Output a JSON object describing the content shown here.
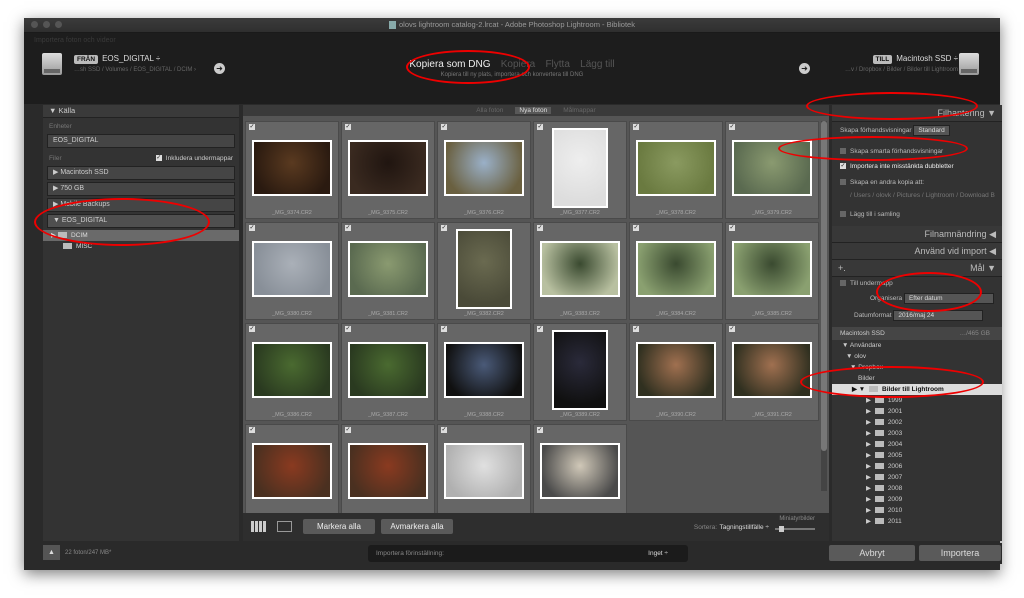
{
  "window": {
    "title": "olovs lightroom catalog-2.lrcat - Adobe Photoshop Lightroom - Bibliotek"
  },
  "top": {
    "faded": "Importera foton och videor",
    "from": {
      "badge": "FRÅN",
      "name": "EOS_DIGITAL ÷",
      "path": "…sh SSD / Volumes / EOS_DIGITAL / DCIM ›"
    },
    "modes": [
      "Kopiera som DNG",
      "Kopiera",
      "Flytta",
      "Lägg till"
    ],
    "mode_sub": "Kopiera till ny plats, importera och konvertera till DNG",
    "to": {
      "badge": "TILL",
      "name": "Macintosh SSD ÷",
      "path": "…v / Dropbox / Bilder / Bilder till Lightroom"
    }
  },
  "left": {
    "title": "Källa",
    "devices_h": "Enheter",
    "device": "EOS_DIGITAL",
    "files_h": "Filer",
    "include_sub": "Inkludera undermappar",
    "volumes": [
      "Macintosh SSD",
      "750 GB",
      "Mobile Backups",
      "EOS_DIGITAL"
    ],
    "tree": [
      "DCIM",
      "MISC"
    ]
  },
  "filters": [
    "Alla foton",
    "Nya foton",
    "Målmappar"
  ],
  "photos": [
    {
      "name": "_MG_9374.CR2"
    },
    {
      "name": "_MG_9375.CR2"
    },
    {
      "name": "_MG_9376.CR2"
    },
    {
      "name": "_MG_9377.CR2"
    },
    {
      "name": "_MG_9378.CR2"
    },
    {
      "name": "_MG_9379.CR2"
    },
    {
      "name": "_MG_9380.CR2"
    },
    {
      "name": "_MG_9381.CR2"
    },
    {
      "name": "_MG_9382.CR2"
    },
    {
      "name": "_MG_9383.CR2"
    },
    {
      "name": "_MG_9384.CR2"
    },
    {
      "name": "_MG_9385.CR2"
    },
    {
      "name": "_MG_9386.CR2"
    },
    {
      "name": "_MG_9387.CR2"
    },
    {
      "name": "_MG_9388.CR2"
    },
    {
      "name": "_MG_9389.CR2"
    },
    {
      "name": "_MG_9390.CR2"
    },
    {
      "name": "_MG_9391.CR2"
    },
    {
      "name": ""
    },
    {
      "name": ""
    },
    {
      "name": ""
    },
    {
      "name": ""
    }
  ],
  "toolbar": {
    "select_all": "Markera alla",
    "deselect_all": "Avmarkera alla",
    "sort_label": "Sortera:",
    "sort_value": "Tagningstillfälle ÷",
    "thumbs_label": "Miniatyrbilder"
  },
  "right": {
    "file_handling": "Filhantering",
    "previews_label": "Skapa förhandsvisningar",
    "previews_value": "Standard",
    "smart": "Skapa smarta förhandsvisningar",
    "dupes": "Importera inte misstänkta dubbletter",
    "second_copy": "Skapa en andra kopia att:",
    "second_path": "/ Users / olovk / Pictures / Lightroom / Download B",
    "collection": "Lägg till i samling",
    "file_rename": "Filnamnändring",
    "apply": "Använd vid import",
    "dest": "Mål",
    "subfolder": "Till undermapp",
    "organize_label": "Organisera",
    "organize_value": "Efter datum",
    "date_label": "Datumformat",
    "date_value": "2016/maj 24",
    "volume": "Macintosh SSD",
    "volume_free": "…/465 GB",
    "tree": [
      "Användare",
      "olov",
      "Dropbox",
      "Bilder",
      "Bilder till Lightroom",
      "1999",
      "2001",
      "2002",
      "2003",
      "2004",
      "2005",
      "2006",
      "2007",
      "2008",
      "2009",
      "2010",
      "2011"
    ]
  },
  "bottom": {
    "count": "22 foton/247 MB*",
    "preset_label": "Importera förinställning:",
    "preset_value": "Inget ÷",
    "cancel": "Avbryt",
    "import": "Importera"
  }
}
